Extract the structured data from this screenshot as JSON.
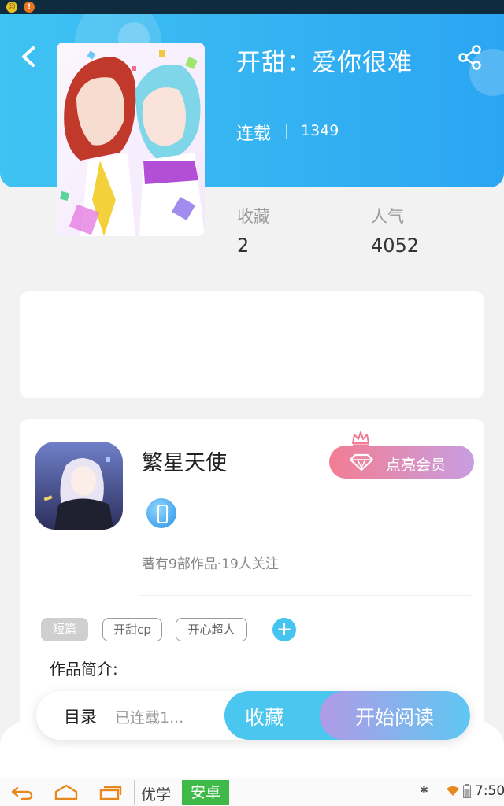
{
  "header": {
    "title": "开甜：爱你很难",
    "status": "连载",
    "chapter_count": "1349"
  },
  "stats": {
    "favorites_label": "收藏",
    "favorites_value": "2",
    "popularity_label": "人气",
    "popularity_value": "4052"
  },
  "author": {
    "name": "繁星天使",
    "meta": "著有9部作品·19人关注",
    "vip_button": "点亮会员"
  },
  "tags": [
    "短篇",
    "开甜cp",
    "开心超人"
  ],
  "add_tag": "+",
  "intro_label": "作品简介:",
  "action_bar": {
    "toc_label": "目录",
    "toc_sub": "已连载1...",
    "favorite_button": "收藏",
    "read_button": "开始阅读"
  },
  "navbar": {
    "ime_left": "优学",
    "ime_right": "安卓",
    "time": "7:50"
  },
  "colors": {
    "header_gradient_start": "#3fc3f2",
    "header_gradient_end": "#2ba5f2",
    "accent_blue": "#4ac6ef",
    "vip_gradient_start": "#f37d93",
    "vip_gradient_end": "#c79ee0"
  },
  "icons": [
    "back-arrow-icon",
    "share-icon",
    "gem-icon",
    "crown-icon",
    "level-badge-icon",
    "add-icon",
    "nav-back-icon",
    "nav-home-icon",
    "nav-recent-icon",
    "bluetooth-icon",
    "wifi-icon",
    "battery-icon"
  ]
}
